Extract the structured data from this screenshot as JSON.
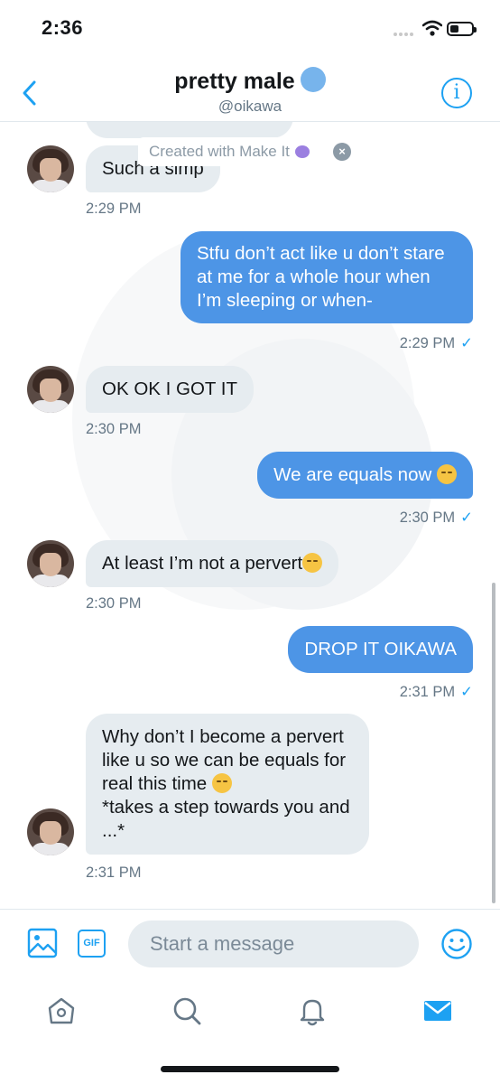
{
  "status_bar": {
    "time": "2:36"
  },
  "header": {
    "title": "pretty male",
    "handle": "@oikawa"
  },
  "watermark": {
    "text": "Created with Make It"
  },
  "messages": [
    {
      "side": "in",
      "text": "Such a simp",
      "time": "2:29 PM"
    },
    {
      "side": "out",
      "text": "Stfu don’t act like u don’t stare at me for a whole hour when I’m sleeping or when-",
      "time": "2:29 PM"
    },
    {
      "side": "in",
      "text": "OK OK I GOT IT",
      "time": "2:30 PM"
    },
    {
      "side": "out",
      "text": "We are equals now",
      "time": "2:30 PM"
    },
    {
      "side": "in",
      "text": "At least I’m not a pervert",
      "time": "2:30 PM"
    },
    {
      "side": "out",
      "text": "DROP IT OIKAWA",
      "time": "2:31 PM"
    },
    {
      "side": "in",
      "text": "Why don’t I become a pervert like u so we can be equals for real this time",
      "text2": "*takes a step towards you and ...*",
      "time": "2:31 PM"
    }
  ],
  "compose": {
    "placeholder": "Start a message",
    "gif_label": "GIF"
  },
  "icons": {
    "back": "chevron-left-icon",
    "info": "info-icon",
    "image": "image-icon",
    "gif": "gif-icon",
    "emoji": "emoji-icon",
    "home": "home-icon",
    "search": "search-icon",
    "notifications": "bell-icon",
    "messages": "mail-icon"
  },
  "colors": {
    "accent": "#1da1f2",
    "outgoing_bubble": "#4d95e6",
    "incoming_bubble": "#e6ecf0",
    "muted_text": "#657786"
  }
}
